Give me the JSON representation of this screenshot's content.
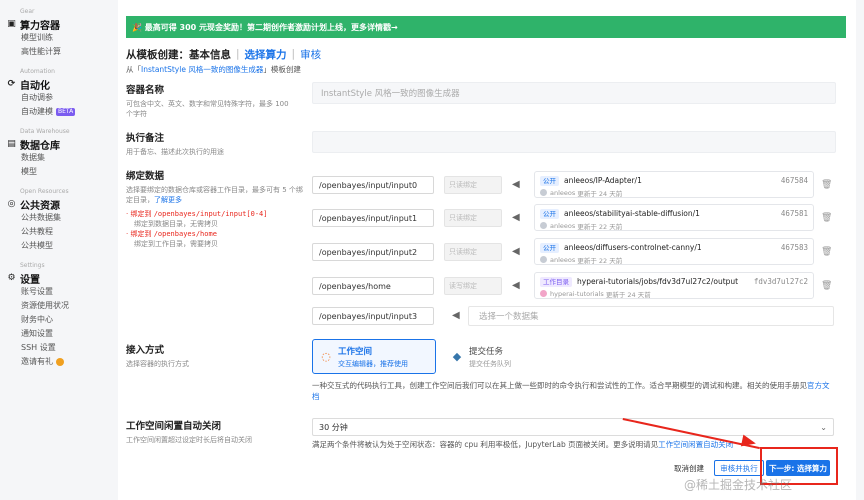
{
  "sidebar": {
    "groups": [
      {
        "en": "Gear",
        "title": "算力容器",
        "icon": "chip-icon",
        "items": [
          "模型训练",
          "高性能计算"
        ]
      },
      {
        "en": "Automation",
        "title": "自动化",
        "icon": "flow-icon",
        "items": [
          "自动调参",
          "自动建模"
        ],
        "beta": "BETA"
      },
      {
        "en": "Data Warehouse",
        "title": "数据仓库",
        "icon": "database-icon",
        "items": [
          "数据集",
          "模型"
        ]
      },
      {
        "en": "Open Resources",
        "title": "公共资源",
        "icon": "globe-icon",
        "items": [
          "公共数据集",
          "公共教程",
          "公共模型"
        ]
      },
      {
        "en": "Settings",
        "title": "设置",
        "icon": "gear-icon",
        "items": [
          "账号设置",
          "资源使用状况",
          "财务中心",
          "通知设置",
          "SSH 设置",
          "邀请有礼"
        ]
      }
    ]
  },
  "banner": "🎉 最高可得 300 元现金奖励！第二期创作者激励计划上线，更多详情戳→",
  "breadcrumb": {
    "step1": "从模板创建：基本信息",
    "sep": "|",
    "step2": "选择算力",
    "step3": "审核"
  },
  "template_line": {
    "prefix": "从「",
    "link": "InstantStyle 风格一致的图像生成器",
    "suffix": "」模板创建"
  },
  "form": {
    "name": {
      "label": "容器名称",
      "hint": "可包含中文、英文、数字和常见特殊字符，最多 100 个字符",
      "value": "InstantStyle 风格一致的图像生成器"
    },
    "note": {
      "label": "执行备注",
      "hint": "用于备忘、描述此次执行的用途"
    },
    "bind": {
      "label": "绑定数据",
      "hint1": "选择要绑定的数据仓库或容器工作目录，最多可有 5 个绑定目录，",
      "hint_link": "了解更多",
      "b1_prefix": "· 绑定到 ",
      "b1_path": "/openbayes/input/input[0-4]",
      "b1_desc": "绑定到数据目录，无需拷贝",
      "b2_prefix": "· 绑定到 ",
      "b2_path": "/openbayes/home",
      "b2_desc": "绑定到工作目录，需要拷贝",
      "rows": [
        {
          "path": "/openbayes/input/input0",
          "mode": "只读绑定",
          "badge": "公开",
          "name": "anleeos/IP-Adapter/1",
          "id": "467584",
          "user": "anleeos",
          "updated": "更新于 24 天前"
        },
        {
          "path": "/openbayes/input/input1",
          "mode": "只读绑定",
          "badge": "公开",
          "name": "anleeos/stabilityai-stable-diffusion/1",
          "id": "467581",
          "user": "anleeos",
          "updated": "更新于 22 天前"
        },
        {
          "path": "/openbayes/input/input2",
          "mode": "只读绑定",
          "badge": "公开",
          "name": "anleeos/diffusers-controlnet-canny/1",
          "id": "467583",
          "user": "anleeos",
          "updated": "更新于 22 天前"
        },
        {
          "path": "/openbayes/home",
          "mode": "读写绑定",
          "badge": "工作目录",
          "name": "hyperai-tutorials/jobs/fdv3d7ul27c2/output",
          "id": "fdv3d7ul27c2",
          "user": "hyperai-tutorials",
          "updated": "更新于 24 天前"
        }
      ],
      "empty_path": "/openbayes/input/input3",
      "empty_placeholder": "选择一个数据集"
    },
    "access": {
      "label": "接入方式",
      "hint": "选择容器的执行方式",
      "opt1_title": "工作空间",
      "opt1_desc": "交互编辑器，推荐使用",
      "opt2_title": "提交任务",
      "opt2_desc": "提交任务队列",
      "desc": "一种交互式的代码执行工具，创建工作空间后我们可以在其上做一些即时的命令执行和尝试性的工作。适合早期模型的调试和构建。相关的使用手册见",
      "desc_link": "官方文档"
    },
    "idle": {
      "label": "工作空间闲置自动关闭",
      "hint": "工作空间闲置超过设定时长后将自动关闭",
      "value": "30 分钟",
      "desc": "满足两个条件将被认为处于空闲状态：容器的 cpu 利用率极低，JupyterLab 页面被关闭。更多说明请见",
      "desc_link": "工作空间闲置自动关闭"
    }
  },
  "actions": {
    "cancel": "取消创建",
    "review": "审核并执行",
    "next": "下一步: 选择算力"
  },
  "watermark": "@稀土掘金技术社区",
  "colors": {
    "accent": "#1a73e8",
    "banner": "#2fb36a",
    "highlight": "#e8261c"
  }
}
